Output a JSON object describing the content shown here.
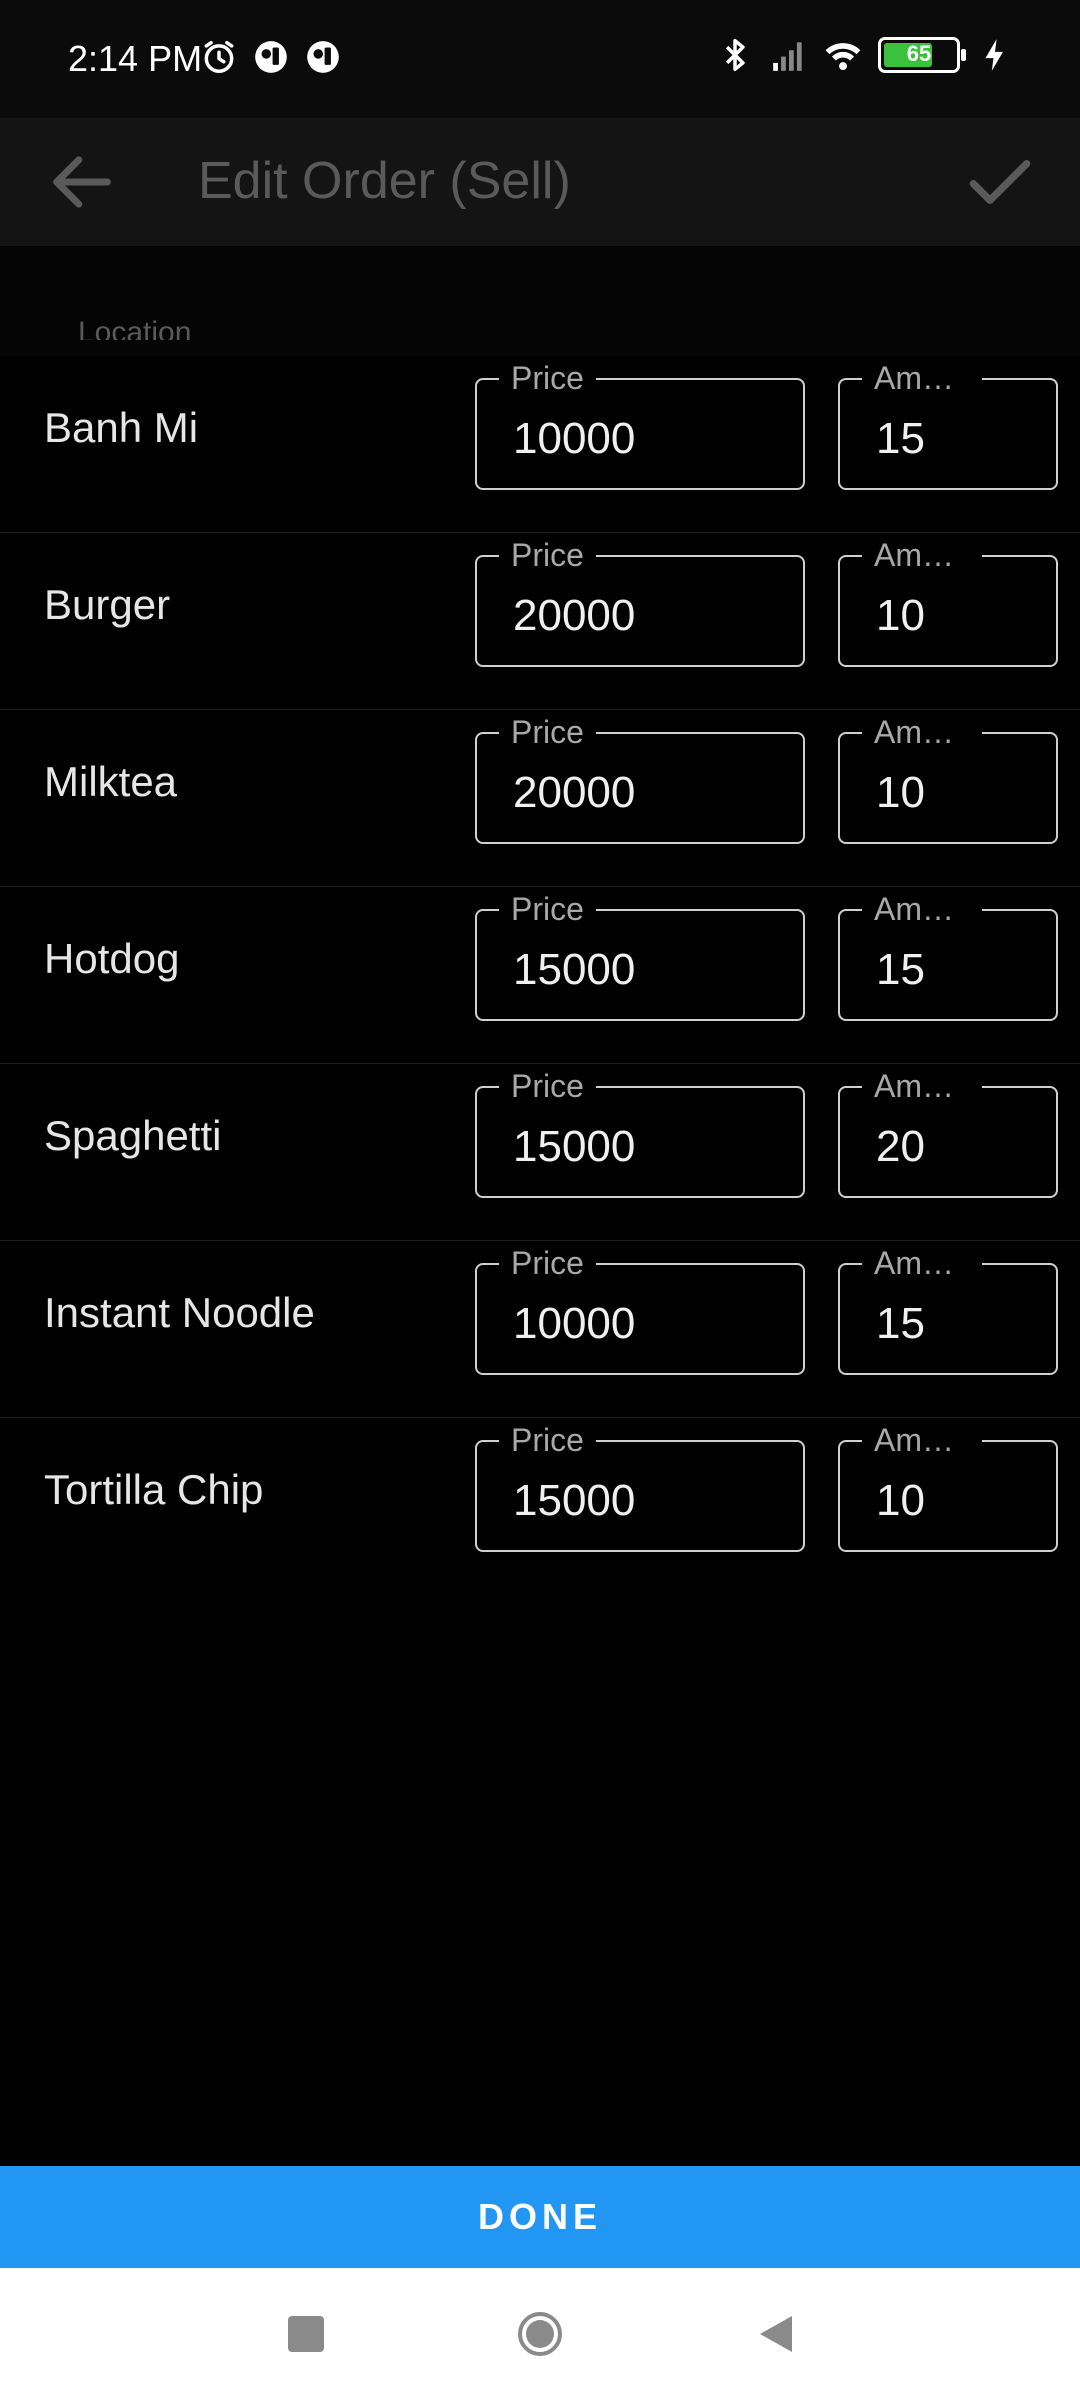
{
  "status_bar": {
    "time": "2:14 PM",
    "left_icons": [
      "alarm-icon",
      "notification-app-icon",
      "notification-app-icon"
    ],
    "right_icons": [
      "bluetooth-icon",
      "signal-icon",
      "wifi-icon",
      "battery-icon",
      "charging-icon"
    ],
    "battery_level": "65"
  },
  "app_bar": {
    "title": "Edit Order (Sell)",
    "back_icon": "arrow-left-icon",
    "confirm_icon": "check-icon"
  },
  "location_label": "Location",
  "items": [
    {
      "name": "Banh Mi",
      "price_label": "Price",
      "price": "10000",
      "amount_label": "Amount",
      "amount": "15"
    },
    {
      "name": "Burger",
      "price_label": "Price",
      "price": "20000",
      "amount_label": "Amount",
      "amount": "10"
    },
    {
      "name": "Milktea",
      "price_label": "Price",
      "price": "20000",
      "amount_label": "Amount",
      "amount": "10"
    },
    {
      "name": "Hotdog",
      "price_label": "Price",
      "price": "15000",
      "amount_label": "Amount",
      "amount": "15"
    },
    {
      "name": "Spaghetti",
      "price_label": "Price",
      "price": "15000",
      "amount_label": "Amount",
      "amount": "20"
    },
    {
      "name": "Instant Noodle",
      "price_label": "Price",
      "price": "10000",
      "amount_label": "Amount",
      "amount": "15"
    },
    {
      "name": "Tortilla Chip",
      "price_label": "Price",
      "price": "15000",
      "amount_label": "Amount",
      "amount": "10"
    }
  ],
  "done_button": "DONE",
  "nav_bar": [
    "recents-square-icon",
    "home-circle-icon",
    "back-triangle-icon"
  ],
  "colors": {
    "accent": "#2196f3",
    "background": "#000000",
    "battery": "#3cc13c"
  }
}
